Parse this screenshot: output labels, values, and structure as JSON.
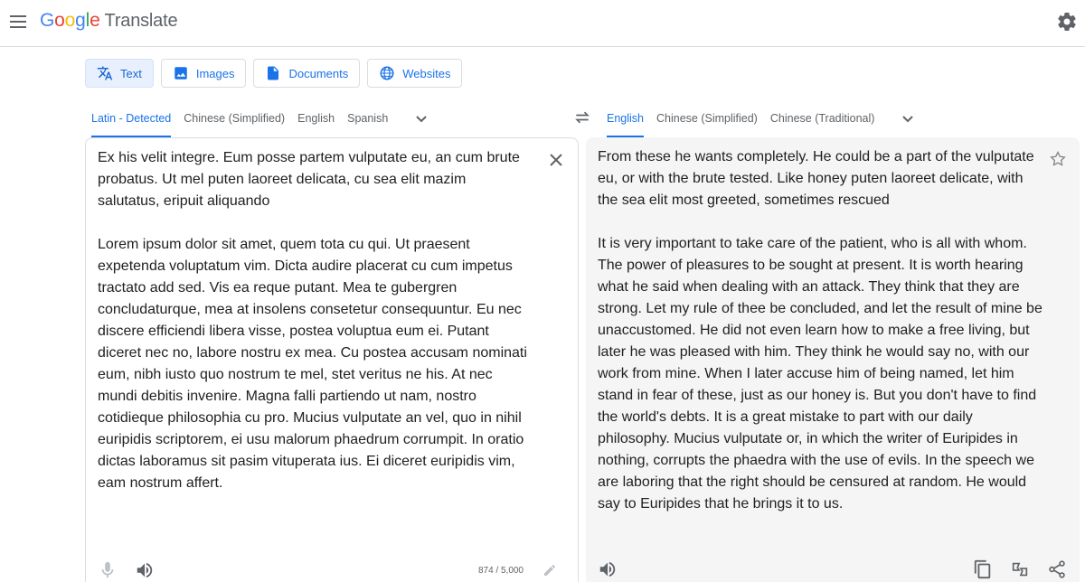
{
  "app": {
    "logo_text": "Google",
    "product_name": "Translate"
  },
  "colors": {
    "accent": "#1a73e8",
    "logo_blue": "#4285f4",
    "logo_red": "#ea4335",
    "logo_yellow": "#fbbc05",
    "logo_green": "#34a853"
  },
  "modes": [
    {
      "label": "Text",
      "icon": "translate-icon",
      "active": true
    },
    {
      "label": "Images",
      "icon": "image-icon",
      "active": false
    },
    {
      "label": "Documents",
      "icon": "document-icon",
      "active": false
    },
    {
      "label": "Websites",
      "icon": "globe-icon",
      "active": false
    }
  ],
  "source_langs": [
    "Latin - Detected",
    "Chinese (Simplified)",
    "English",
    "Spanish"
  ],
  "target_langs": [
    "English",
    "Chinese (Simplified)",
    "Chinese (Traditional)"
  ],
  "source_text": "Ex his velit integre. Eum posse partem vulputate eu, an cum brute probatus. Ut mel puten laoreet delicata, cu sea elit mazim salutatus, eripuit aliquando\n\nLorem ipsum dolor sit amet, quem tota cu qui. Ut praesent expetenda voluptatum vim. Dicta audire placerat cu cum impetus tractato add sed. Vis ea reque putant. Mea te gubergren concludaturque, mea at insolens consetetur consequuntur. Eu nec discere efficiendi libera visse, postea voluptua eum ei. Putant diceret nec no, labore nostru ex mea. Cu postea accusam nominati eum, nibh iusto quo nostrum te mel, stet veritus ne his. At nec mundi debitis invenire. Magna falli partiendo ut nam, nostro cotidieque philosophia cu pro. Mucius vulputate an vel, quo in nihil euripidis scriptorem, ei usu malorum phaedrum corrumpit. In oratio dictas laboramus sit pasim vituperata ius. Ei diceret euripidis vim, eam nostrum affert.",
  "translated_text": "From these he wants completely. He could be a part of the vulputate eu, or with the brute tested. Like honey puten laoreet delicate, with the sea elit most greeted, sometimes rescued\n\nIt is very important to take care of the patient, who is all with whom. The power of pleasures to be sought at present. It is worth hearing what he said when dealing with an attack. They think that they are strong. Let my rule of thee be concluded, and let the result of mine be unaccustomed. He did not even learn how to make a free living, but later he was pleased with him. They think he would say no, with our work from mine. When I later accuse him of being named, let him stand in fear of these, just as our honey is. But you don't have to find the world's debts. It is a great mistake to part with our daily philosophy. Mucius vulputate or, in which the writer of Euripides in nothing, corrupts the phaedra with the use of evils. In the speech we are laboring that the right should be censured at random. He would say to Euripides that he brings it to us.",
  "char_count": "874 / 5,000"
}
